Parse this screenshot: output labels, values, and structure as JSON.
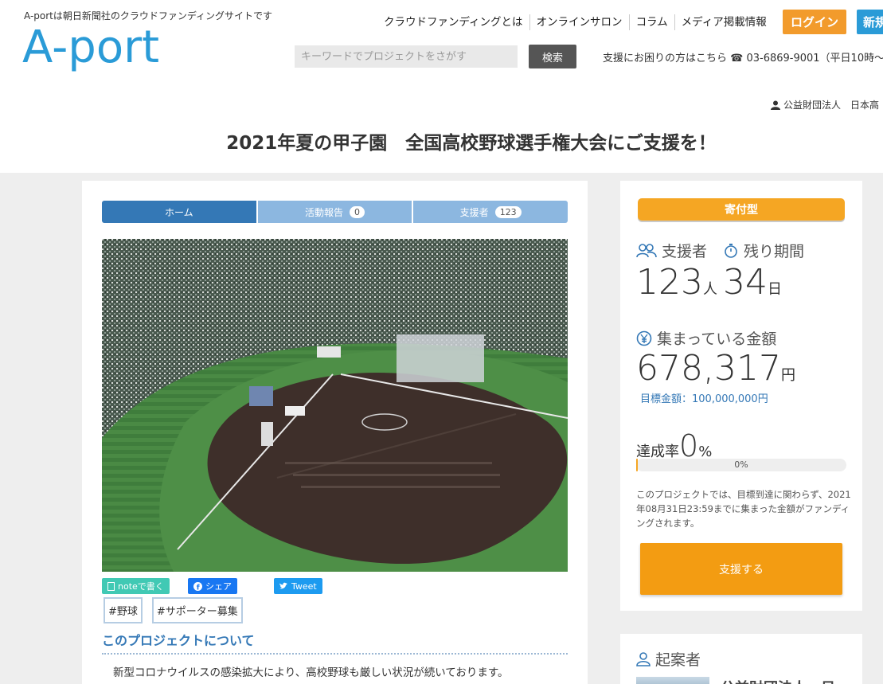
{
  "header": {
    "tagline": "A-portは朝日新聞社のクラウドファンディングサイトです",
    "logo_text": "A-port",
    "nav": [
      "クラウドファンディングとは",
      "オンラインサロン",
      "コラム",
      "メディア掲載情報"
    ],
    "login_label": "ログイン",
    "register_label": "新規",
    "search_placeholder": "キーワードでプロジェクトをさがす",
    "search_button": "検索",
    "support_contact": "支援にお困りの方はこちら ☎ 03-6869-9001（平日10時～",
    "owner": "公益財団法人　日本高"
  },
  "page_title": "2021年夏の甲子園　全国高校野球選手権大会にご支援を！",
  "tabs": [
    {
      "label": "ホーム",
      "count": ""
    },
    {
      "label": "活動報告",
      "count": "0"
    },
    {
      "label": "支援者",
      "count": "123"
    }
  ],
  "share": {
    "note": "noteで書く",
    "facebook": "シェア",
    "twitter": "Tweet"
  },
  "tags": [
    "#野球",
    "#サポーター募集"
  ],
  "section": {
    "title": "このプロジェクトについて",
    "body": "新型コロナウイルスの感染拡大により、高校野球も厳しい状況が続いております。"
  },
  "sidebar": {
    "type_badge": "寄付型",
    "supporters_label": "支援者",
    "supporters_value": "123",
    "supporters_unit": "人",
    "remaining_label": "残り期間",
    "remaining_value": "34",
    "remaining_unit": "日",
    "amount_label": "集まっている金額",
    "amount_value": "678,317",
    "amount_unit": "円",
    "goal": "目標金額：100,000,000円",
    "rate_label": "達成率",
    "rate_value": "0",
    "rate_unit": "%",
    "progress_text": "0%",
    "progress_fraction": 0.0068,
    "note": "このプロジェクトでは、目標到達に関わらず、2021年08月31日23:59までに集まった金額がファンディングされます。",
    "support_button": "支援する",
    "originator_label": "起案者",
    "originator_name": "公益財団法人　日"
  },
  "colors": {
    "brand_blue": "#2a9bd7",
    "orange": "#f39c12",
    "tab_active": "#3478b6",
    "tab_inactive": "#8cb7e0"
  }
}
